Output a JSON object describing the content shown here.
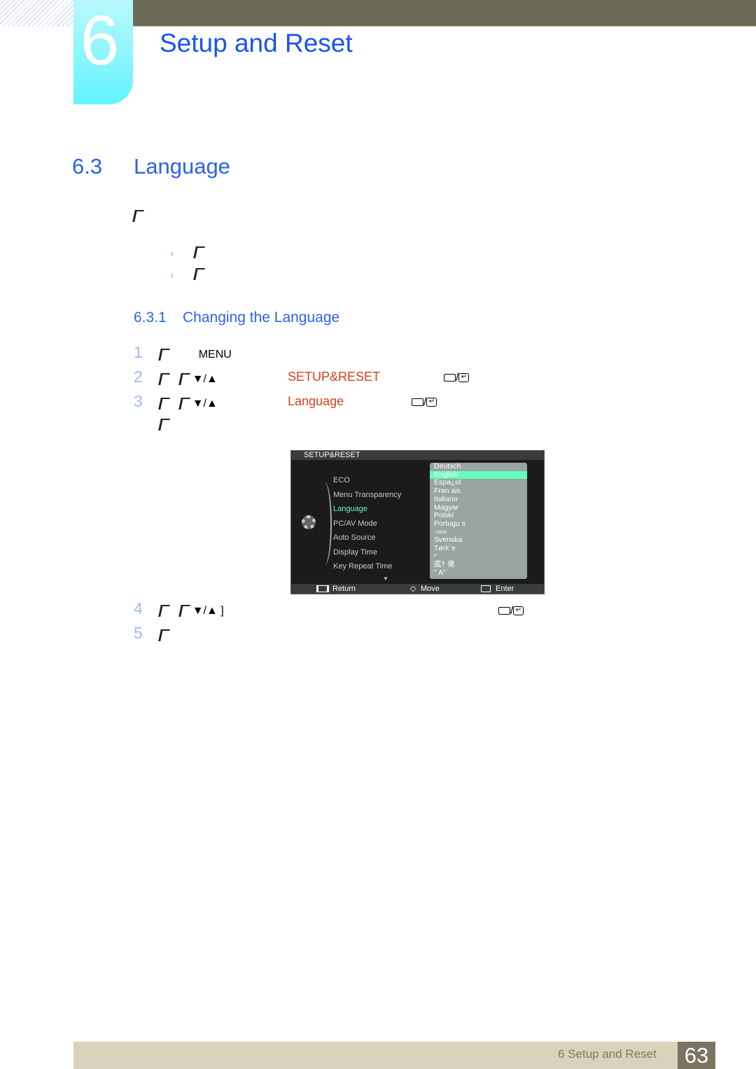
{
  "header": {
    "chapter_number": "6",
    "chapter_title": "Setup and Reset"
  },
  "section": {
    "number": "6.3",
    "title": "Language"
  },
  "subsection": {
    "number": "6.3.1",
    "title": "Changing the Language"
  },
  "bullets": [
    "z",
    "z"
  ],
  "steps": [
    {
      "num": "1",
      "key": "MENU"
    },
    {
      "num": "2",
      "arrows": "▼/▲",
      "highlight": "SETUP&RESET"
    },
    {
      "num": "3",
      "arrows": "▼/▲",
      "highlight": "Language"
    },
    {
      "num": "4",
      "arrows": "▼/▲ ]"
    },
    {
      "num": "5"
    }
  ],
  "osd": {
    "title": "SETUP&RESET",
    "items": [
      "ECO",
      "Menu Transparency",
      "Language",
      "PC/AV Mode",
      "Auto Source",
      "Display Time",
      "Key Repeat Time"
    ],
    "active_item": "Language",
    "languages": [
      "Deutsch",
      "English",
      "Espa¿ol",
      "Fran ais",
      "Italiano",
      "Magyar",
      "Polski",
      "Portugu s",
      "¬ѕѕѕѕ",
      "Svenska",
      "Tørk´e",
      "ª˜",
      "底† 偖",
      "\" A\""
    ],
    "selected_language": "English",
    "footer": {
      "return": "Return",
      "move": "Move",
      "enter": "Enter"
    },
    "colors": {
      "highlight": "#66fcbd",
      "active_text": "#66fcbd"
    }
  },
  "footer": {
    "text": "6 Setup and Reset",
    "page": "63"
  },
  "colors": {
    "heading": "#2a63f0",
    "highlight": "#d4421a"
  }
}
